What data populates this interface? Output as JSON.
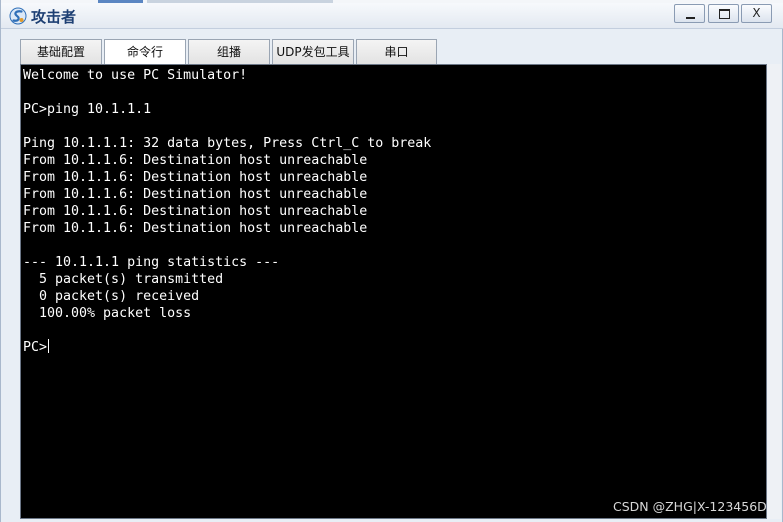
{
  "window": {
    "title": "攻击者",
    "controls": {
      "minimize": "",
      "maximize": "",
      "close": "X"
    }
  },
  "tabs": [
    {
      "label": "基础配置",
      "active": false
    },
    {
      "label": "命令行",
      "active": true
    },
    {
      "label": "组播",
      "active": false
    },
    {
      "label": "UDP发包工具",
      "active": false
    },
    {
      "label": "串口",
      "active": false
    }
  ],
  "terminal": {
    "lines": [
      "Welcome to use PC Simulator!",
      "",
      "PC>ping 10.1.1.1",
      "",
      "Ping 10.1.1.1: 32 data bytes, Press Ctrl_C to break",
      "From 10.1.1.6: Destination host unreachable",
      "From 10.1.1.6: Destination host unreachable",
      "From 10.1.1.6: Destination host unreachable",
      "From 10.1.1.6: Destination host unreachable",
      "From 10.1.1.6: Destination host unreachable",
      "",
      "--- 10.1.1.1 ping statistics ---",
      "  5 packet(s) transmitted",
      "  0 packet(s) received",
      "  100.00% packet loss",
      "",
      "PC>"
    ]
  },
  "watermark": "CSDN @ZHG|X-123456D",
  "colors": {
    "terminal_bg": "#000000",
    "terminal_text": "#ffffff",
    "title_text": "#1d3f73"
  }
}
